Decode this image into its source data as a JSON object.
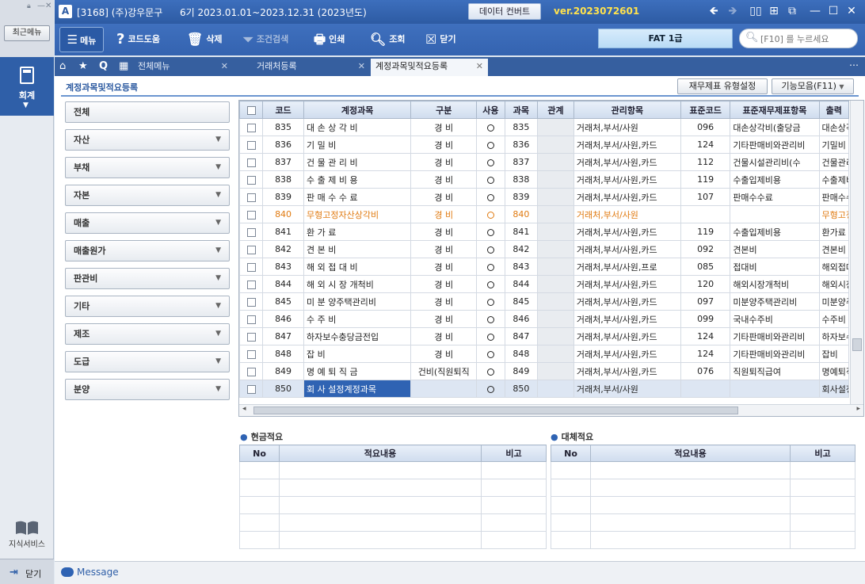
{
  "app": {
    "company": "[3168]  (주)강우문구",
    "period": "6기  2023.01.01~2023.12.31  (2023년도)",
    "convert_label": "데이터 컨버트",
    "version": "ver.2023072601",
    "fat_label": "FAT 1급",
    "search_placeholder": "[F10] 를 누르세요",
    "recent_menu": "최근메뉴",
    "accounting": "회계",
    "knowledge": "지식서비스",
    "close": "닫기",
    "message": "Message"
  },
  "toolbar": {
    "menu": "메뉴",
    "code_help": "코드도움",
    "delete": "삭제",
    "condition_search": "조건검색",
    "print": "인쇄",
    "lookup": "조회",
    "close": "닫기"
  },
  "tabs": [
    {
      "label": "전체메뉴"
    },
    {
      "label": "거래처등록"
    },
    {
      "label": "계정과목및적요등록"
    }
  ],
  "page": {
    "title": "계정과목및적요등록",
    "btn_fs_type": "재무제표 유형설정",
    "btn_functions": "기능모음(F11)"
  },
  "categories": [
    "전체",
    "자산",
    "부채",
    "자본",
    "매출",
    "매출원가",
    "판관비",
    "기타",
    "제조",
    "도급",
    "분양"
  ],
  "grid": {
    "headers": [
      "코드",
      "계정과목",
      "구분",
      "사용",
      "과목",
      "관계",
      "관리항목",
      "표준코드",
      "표준재무제표항목",
      "출력"
    ],
    "rows": [
      [
        "835",
        "대 손 상 각 비",
        "경 비",
        "835",
        "거래처,부서/사원",
        "096",
        "대손상각비(출당금",
        "대손상각"
      ],
      [
        "836",
        "기 밀 비",
        "경 비",
        "836",
        "거래처,부서/사원,카드",
        "124",
        "기타판매비와관리비",
        "기밀비"
      ],
      [
        "837",
        "건 물 관 리 비",
        "경 비",
        "837",
        "거래처,부서/사원,카드",
        "112",
        "건물시설관리비(수",
        "건물관리"
      ],
      [
        "838",
        "수 출 제 비 용",
        "경 비",
        "838",
        "거래처,부서/사원,카드",
        "119",
        "수출입제비용",
        "수출제비"
      ],
      [
        "839",
        "판 매 수 수 료",
        "경 비",
        "839",
        "거래처,부서/사원,카드",
        "107",
        "판매수수료",
        "판매수수"
      ],
      [
        "840",
        "무형고정자산상각비",
        "경 비",
        "840",
        "거래처,부서/사원",
        "",
        "",
        "무형고정"
      ],
      [
        "841",
        "환 가 료",
        "경 비",
        "841",
        "거래처,부서/사원,카드",
        "119",
        "수출입제비용",
        "환가료"
      ],
      [
        "842",
        "견 본 비",
        "경 비",
        "842",
        "거래처,부서/사원,카드",
        "092",
        "견본비",
        "견본비"
      ],
      [
        "843",
        "해 외 접 대 비",
        "경 비",
        "843",
        "거래처,부서/사원,프로",
        "085",
        "접대비",
        "해외접대"
      ],
      [
        "844",
        "해 외 시 장 개척비",
        "경 비",
        "844",
        "거래처,부서/사원,카드",
        "120",
        "해외시장개척비",
        "해외시장"
      ],
      [
        "845",
        "미 분 양주택관리비",
        "경 비",
        "845",
        "거래처,부서/사원,카드",
        "097",
        "미분양주택관리비",
        "미분양주"
      ],
      [
        "846",
        "수 주 비",
        "경 비",
        "846",
        "거래처,부서/사원,카드",
        "099",
        "국내수주비",
        "수주비"
      ],
      [
        "847",
        "하자보수충당금전입",
        "경 비",
        "847",
        "거래처,부서/사원,카드",
        "124",
        "기타판매비와관리비",
        "하자보수"
      ],
      [
        "848",
        "잡 비",
        "경 비",
        "848",
        "거래처,부서/사원,카드",
        "124",
        "기타판매비와관리비",
        "잡비"
      ],
      [
        "849",
        "명 예 퇴 직 금",
        "건비(직원퇴직",
        "849",
        "거래처,부서/사원,카드",
        "076",
        "직원퇴직급여",
        "명예퇴직"
      ],
      [
        "850",
        "회 사 설정계정과목",
        "",
        "850",
        "거래처,부서/사원",
        "",
        "",
        "회사설정"
      ]
    ]
  },
  "cash_summary": {
    "title": "현금적요",
    "headers": [
      "No",
      "적요내용",
      "비고"
    ]
  },
  "transfer_summary": {
    "title": "대체적요",
    "headers": [
      "No",
      "적요내용",
      "비고"
    ]
  },
  "colors": {
    "accent": "#2f63b3",
    "orange": "#e07a10",
    "title_bar": "#2d5ba3"
  }
}
